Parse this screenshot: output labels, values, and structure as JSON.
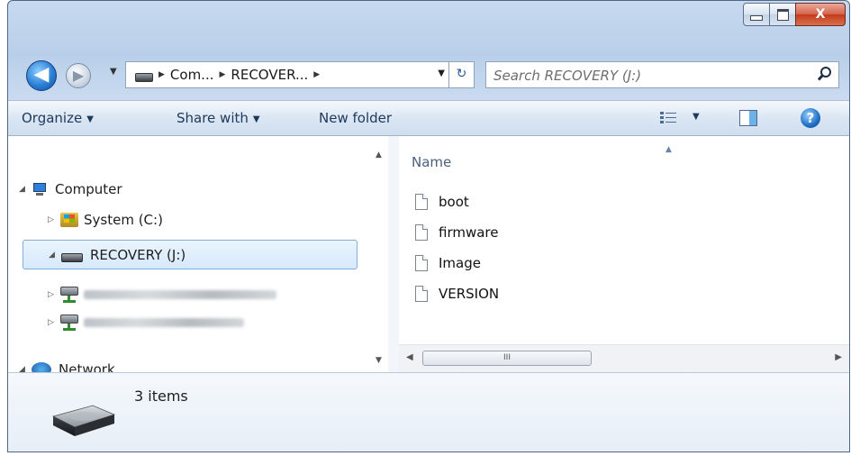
{
  "window": {
    "caption_min_icon": "minimize-icon",
    "caption_max_icon": "maximize-icon",
    "caption_close_label": "X"
  },
  "nav": {
    "back_glyph": "◀",
    "forward_glyph": "▶",
    "recent_glyph": "▼"
  },
  "address": {
    "crumbs": [
      "Com...",
      "RECOVER..."
    ],
    "arrow_glyph": "▶",
    "dropdown_glyph": "▼",
    "refresh_glyph": "↻"
  },
  "search": {
    "placeholder": "Search RECOVERY (J:)",
    "icon": "search-icon"
  },
  "commandbar": {
    "organize": "Organize",
    "share_with": "Share with",
    "new_folder": "New folder",
    "dropdown_glyph": "▼",
    "help_glyph": "?"
  },
  "navpane": {
    "computer": "Computer",
    "system": "System (C:)",
    "recovery": "RECOVERY (J:)",
    "network": "Network",
    "expanded_glyph": "◢",
    "collapsed_glyph": "▷"
  },
  "filepane": {
    "column_name": "Name",
    "sort_glyph": "▲",
    "files": [
      "boot",
      "firmware",
      "Image",
      "VERSION"
    ],
    "hscroll_grip": "III"
  },
  "details": {
    "item_count": "3 items"
  }
}
